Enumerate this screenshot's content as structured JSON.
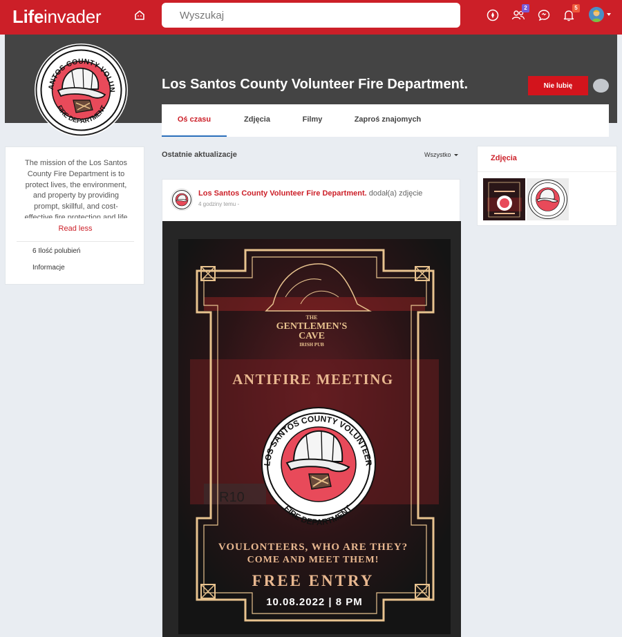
{
  "app": {
    "brand_bold": "Life",
    "brand_light": "invader"
  },
  "search": {
    "placeholder": "Wyszukaj"
  },
  "topbar": {
    "friends_badge": "2",
    "notifications_badge": "5",
    "colors": {
      "bar": "#cc1f28",
      "friends_badge": "#7b5bd6",
      "notifications_badge": "#ef5a3c"
    }
  },
  "page": {
    "title": "Los Santos County Volunteer Fire Department.",
    "dislike_button": "Nie lubię"
  },
  "tabs": [
    {
      "label": "Oś czasu",
      "active": true
    },
    {
      "label": "Zdjęcia",
      "active": false
    },
    {
      "label": "Filmy",
      "active": false
    },
    {
      "label": "Zaproś znajomych",
      "active": false
    }
  ],
  "sidebar": {
    "about": "The mission of the Los Santos County Fire Department is to protect lives, the environment, and property by providing prompt, skillful, and cost-effective fire protection and life safety services.",
    "read_less": "Read less",
    "likes": "6 Ilość polubień",
    "info": "Informacje"
  },
  "feed": {
    "header": "Ostatnie aktualizacje",
    "filter": "Wszystko"
  },
  "post": {
    "author": "Los Santos County Volunteer Fire Department.",
    "action": "dodał(a) zdjęcie",
    "time": "4 godziny temu -",
    "poster": {
      "logo_top": "THE",
      "logo_name_1": "GENTLEMEN'S",
      "logo_name_2": "CAVE",
      "logo_sub": "IRISH PUB",
      "heading": "ANTIFIRE MEETING",
      "line1": "VOULONTEERS, WHO ARE THEY?",
      "line2": "COME AND MEET THEM!",
      "entry": "FREE ENTRY",
      "date": "10.08.2022 | 8 PM",
      "badge_text_top": "LOS SANTOS COUNTY VOLUNTEER",
      "badge_text_bottom": "FIRE DEPARTMENT",
      "plate": "R10"
    }
  },
  "photos_widget": {
    "title": "Zdjęcia"
  }
}
